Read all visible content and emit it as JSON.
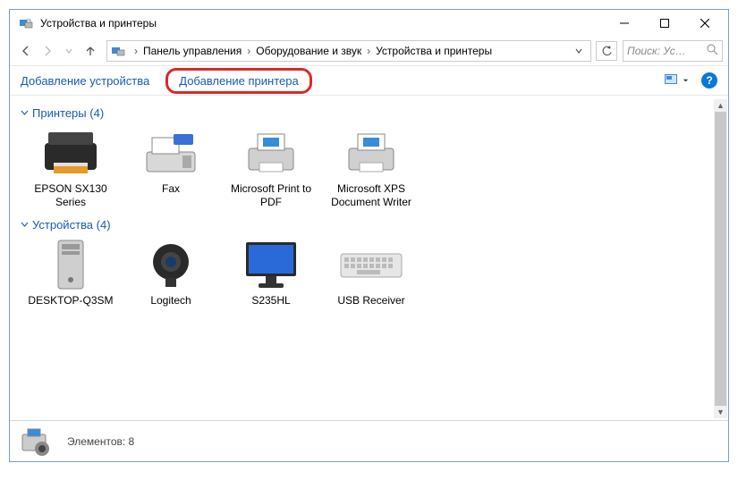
{
  "window": {
    "title": "Устройства и принтеры"
  },
  "breadcrumb": {
    "items": [
      "Панель управления",
      "Оборудование и звук",
      "Устройства и принтеры"
    ]
  },
  "search": {
    "placeholder": "Поиск: Ус…"
  },
  "toolbar": {
    "add_device": "Добавление устройства",
    "add_printer": "Добавление принтера"
  },
  "groups": [
    {
      "title": "Принтеры",
      "count": 4,
      "items": [
        {
          "label": "EPSON SX130 Series",
          "icon": "printer-photo"
        },
        {
          "label": "Fax",
          "icon": "fax"
        },
        {
          "label": "Microsoft Print to PDF",
          "icon": "printer-generic"
        },
        {
          "label": "Microsoft XPS Document Writer",
          "icon": "printer-generic"
        }
      ]
    },
    {
      "title": "Устройства",
      "count": 4,
      "items": [
        {
          "label": "DESKTOP-Q3SM",
          "icon": "pc-tower"
        },
        {
          "label": "Logitech",
          "icon": "webcam"
        },
        {
          "label": "S235HL",
          "icon": "monitor"
        },
        {
          "label": "USB Receiver",
          "icon": "keyboard"
        }
      ]
    }
  ],
  "statusbar": {
    "label": "Элементов:",
    "count": 8
  }
}
